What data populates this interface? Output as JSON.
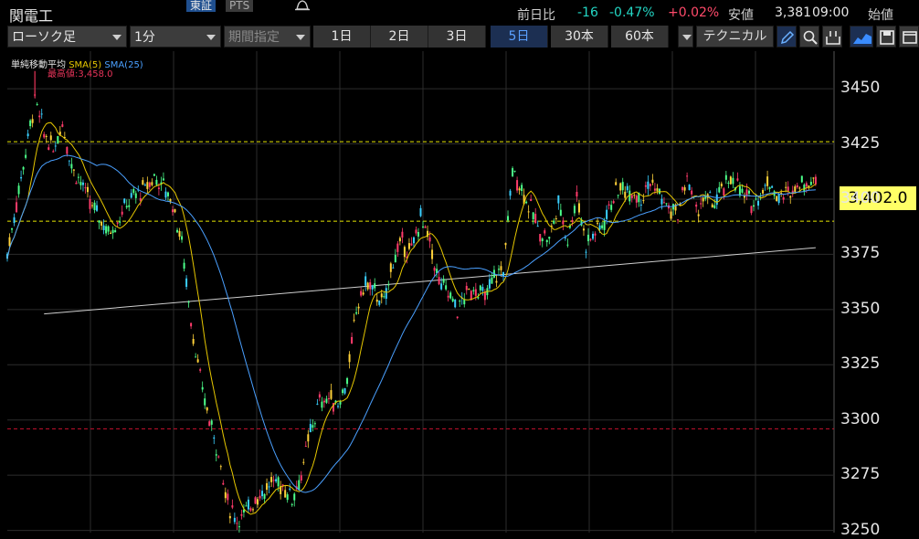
{
  "header": {
    "symbol": "関電工",
    "market_tabs": [
      {
        "label": "東証",
        "active": true
      },
      {
        "label": "PTS",
        "active": false
      }
    ],
    "quote": {
      "change_label": "前日比",
      "change": "-16",
      "change_pct": "-0.47%",
      "change_pct2": "+0.02%",
      "low_label": "安値",
      "low_value": "3,381",
      "low_time": "09:00",
      "open_label": "始値"
    }
  },
  "toolbar": {
    "chart_type": "ローソク足",
    "interval": "1分",
    "period_select": "期間指定",
    "periods": [
      {
        "label": "1日",
        "active": false
      },
      {
        "label": "2日",
        "active": false
      },
      {
        "label": "3日",
        "active": false
      },
      {
        "label": "5日",
        "active": true
      },
      {
        "label": "30本",
        "active": false
      },
      {
        "label": "60本",
        "active": false
      }
    ],
    "technical_label": "テクニカル",
    "icons": [
      "pencil-icon",
      "zoom-icon",
      "output-icon",
      "area-chart-icon",
      "save-icon",
      "window-icon"
    ]
  },
  "chart_data": {
    "type": "line",
    "title": "",
    "legend": [
      {
        "name": "単純移動平均",
        "color": "#e6e6e6"
      },
      {
        "name": "SMA(5)",
        "color": "#e6c700"
      },
      {
        "name": "SMA(25)",
        "color": "#4aa0ff"
      }
    ],
    "high_annotation": "最高値:3,458.0",
    "current_price": "3,402.0",
    "y_ticks": [
      3250,
      3275,
      3300,
      3325,
      3350,
      3375,
      3400,
      3425,
      3450
    ],
    "ylim": [
      3249,
      3467
    ],
    "x_range_bars": [
      0,
      180
    ],
    "reference_lines": [
      {
        "value": 3426,
        "color": "#e6e600",
        "style": "dashed"
      },
      {
        "value": 3390,
        "color": "#e6e600",
        "style": "dashed"
      },
      {
        "value": 3296,
        "color": "#c8102e",
        "style": "dashed"
      }
    ],
    "trend_line": {
      "from": {
        "bar": 8,
        "value": 3348
      },
      "to": {
        "bar": 176,
        "value": 3378
      }
    },
    "price_path": [
      [
        0,
        3375
      ],
      [
        3,
        3410
      ],
      [
        6,
        3445
      ],
      [
        8,
        3430
      ],
      [
        10,
        3422
      ],
      [
        12,
        3435
      ],
      [
        14,
        3415
      ],
      [
        16,
        3408
      ],
      [
        18,
        3398
      ],
      [
        20,
        3392
      ],
      [
        22,
        3385
      ],
      [
        24,
        3390
      ],
      [
        26,
        3398
      ],
      [
        28,
        3402
      ],
      [
        30,
        3405
      ],
      [
        32,
        3410
      ],
      [
        34,
        3406
      ],
      [
        36,
        3398
      ],
      [
        38,
        3380
      ],
      [
        40,
        3345
      ],
      [
        42,
        3318
      ],
      [
        44,
        3300
      ],
      [
        46,
        3285
      ],
      [
        47,
        3272
      ],
      [
        48,
        3262
      ],
      [
        50,
        3255
      ],
      [
        52,
        3258
      ],
      [
        54,
        3265
      ],
      [
        56,
        3268
      ],
      [
        58,
        3272
      ],
      [
        60,
        3270
      ],
      [
        62,
        3265
      ],
      [
        64,
        3275
      ],
      [
        66,
        3295
      ],
      [
        68,
        3308
      ],
      [
        70,
        3310
      ],
      [
        72,
        3307
      ],
      [
        74,
        3318
      ],
      [
        76,
        3350
      ],
      [
        78,
        3362
      ],
      [
        80,
        3358
      ],
      [
        82,
        3352
      ],
      [
        84,
        3373
      ],
      [
        86,
        3380
      ],
      [
        88,
        3376
      ],
      [
        90,
        3392
      ],
      [
        92,
        3380
      ],
      [
        94,
        3362
      ],
      [
        96,
        3358
      ],
      [
        98,
        3350
      ],
      [
        100,
        3357
      ],
      [
        102,
        3360
      ],
      [
        104,
        3355
      ],
      [
        106,
        3365
      ],
      [
        108,
        3368
      ],
      [
        110,
        3413
      ],
      [
        112,
        3405
      ],
      [
        114,
        3395
      ],
      [
        116,
        3385
      ],
      [
        118,
        3382
      ],
      [
        120,
        3398
      ],
      [
        122,
        3382
      ],
      [
        124,
        3402
      ],
      [
        126,
        3380
      ],
      [
        128,
        3385
      ],
      [
        130,
        3390
      ],
      [
        132,
        3402
      ],
      [
        134,
        3405
      ],
      [
        136,
        3404
      ],
      [
        138,
        3401
      ],
      [
        140,
        3408
      ],
      [
        142,
        3402
      ],
      [
        144,
        3395
      ],
      [
        146,
        3393
      ],
      [
        148,
        3410
      ],
      [
        150,
        3395
      ],
      [
        152,
        3400
      ],
      [
        154,
        3398
      ],
      [
        156,
        3405
      ],
      [
        158,
        3410
      ],
      [
        160,
        3402
      ],
      [
        162,
        3398
      ],
      [
        164,
        3403
      ],
      [
        166,
        3408
      ],
      [
        168,
        3400
      ],
      [
        170,
        3403
      ],
      [
        172,
        3407
      ],
      [
        176,
        3408
      ]
    ]
  }
}
